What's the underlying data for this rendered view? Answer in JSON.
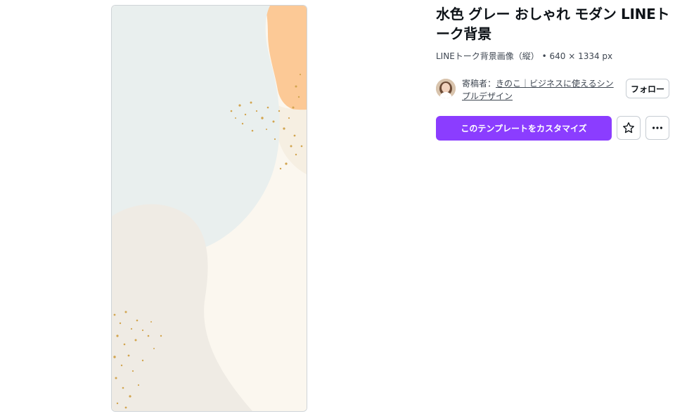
{
  "template": {
    "title": "水色 グレー おしゃれ モダン LINEトーク背景",
    "meta": "LINEトーク背景画像（縦） • 640 × 1334 px",
    "preview_alt": "テンプレートのプレビュー"
  },
  "creator": {
    "prefix": "寄稿者：",
    "name": "きのこ｜ビジネスに使えるシンプルデザイン",
    "follow_label": "フォロー"
  },
  "actions": {
    "customize_label": "このテンプレートをカスタマイズ",
    "star_icon": "star-icon",
    "more_icon": "more-horizontal-icon"
  },
  "colors": {
    "accent": "#8b3dff",
    "preview_mint": "#e9efee",
    "preview_cream": "#fbf7ef",
    "preview_beige": "#efebe4",
    "preview_orange": "#fcc996",
    "gold_flecks": "#d2a550"
  }
}
